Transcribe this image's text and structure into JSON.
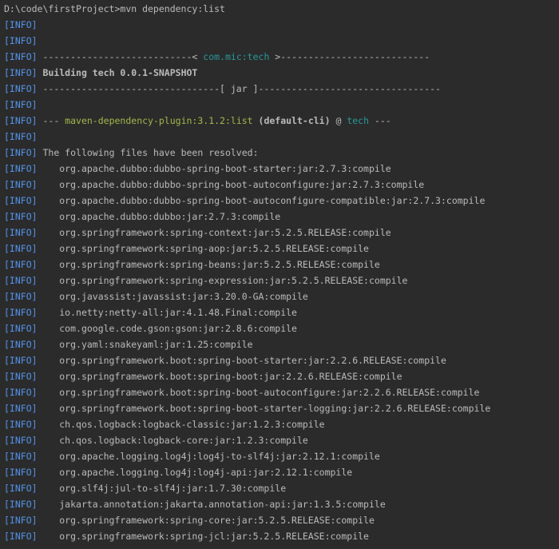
{
  "prompt": "D:\\code\\firstProject>mvn dependency:list",
  "info_tag": "[INFO]",
  "separator_left": "---------------------------< ",
  "group_artifact": "com.mic:tech",
  "separator_right": " >---------------------------",
  "building": "Building tech 0.0.1-SNAPSHOT",
  "jar_line": "--------------------------------[ jar ]---------------------------------",
  "plugin_prefix": "--- ",
  "plugin": "maven-dependency-plugin:3.1.2:list",
  "plugin_exec": " (default-cli)",
  "plugin_at": " @ ",
  "plugin_project": "tech",
  "plugin_suffix": " ---",
  "resolved_header": "The following files have been resolved:",
  "dependencies": [
    "org.apache.dubbo:dubbo-spring-boot-starter:jar:2.7.3:compile",
    "org.apache.dubbo:dubbo-spring-boot-autoconfigure:jar:2.7.3:compile",
    "org.apache.dubbo:dubbo-spring-boot-autoconfigure-compatible:jar:2.7.3:compile",
    "org.apache.dubbo:dubbo:jar:2.7.3:compile",
    "org.springframework:spring-context:jar:5.2.5.RELEASE:compile",
    "org.springframework:spring-aop:jar:5.2.5.RELEASE:compile",
    "org.springframework:spring-beans:jar:5.2.5.RELEASE:compile",
    "org.springframework:spring-expression:jar:5.2.5.RELEASE:compile",
    "org.javassist:javassist:jar:3.20.0-GA:compile",
    "io.netty:netty-all:jar:4.1.48.Final:compile",
    "com.google.code.gson:gson:jar:2.8.6:compile",
    "org.yaml:snakeyaml:jar:1.25:compile",
    "org.springframework.boot:spring-boot-starter:jar:2.2.6.RELEASE:compile",
    "org.springframework.boot:spring-boot:jar:2.2.6.RELEASE:compile",
    "org.springframework.boot:spring-boot-autoconfigure:jar:2.2.6.RELEASE:compile",
    "org.springframework.boot:spring-boot-starter-logging:jar:2.2.6.RELEASE:compile",
    "ch.qos.logback:logback-classic:jar:1.2.3:compile",
    "ch.qos.logback:logback-core:jar:1.2.3:compile",
    "org.apache.logging.log4j:log4j-to-slf4j:jar:2.12.1:compile",
    "org.apache.logging.log4j:log4j-api:jar:2.12.1:compile",
    "org.slf4j:jul-to-slf4j:jar:1.7.30:compile",
    "jakarta.annotation:jakarta.annotation-api:jar:1.3.5:compile",
    "org.springframework:spring-core:jar:5.2.5.RELEASE:compile",
    "org.springframework:spring-jcl:jar:5.2.5.RELEASE:compile"
  ],
  "colors": {
    "background": "#2b2b2b",
    "text": "#bbbbbb",
    "info_tag": "#5394ec",
    "artifact": "#299999",
    "plugin": "#a2b84a"
  }
}
